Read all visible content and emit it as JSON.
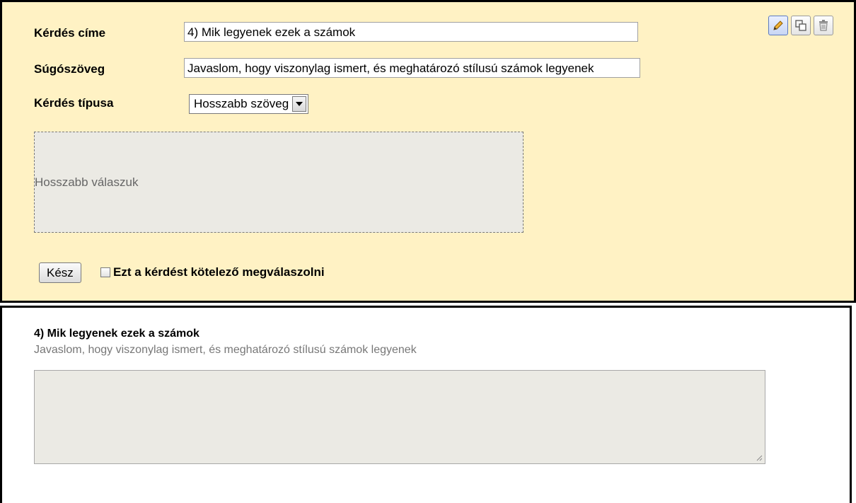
{
  "editor": {
    "title_label": "Kérdés címe",
    "title_value": "4) Mik legyenek ezek a számok",
    "help_label": "Súgószöveg",
    "help_value": "Javaslom, hogy viszonylag ismert, és meghatározó stílusú számok legyenek",
    "type_label": "Kérdés típusa",
    "type_selected": "Hosszabb szöveg",
    "answer_placeholder": "Hosszabb válaszuk",
    "done_button": "Kész",
    "required_label": "Ezt a kérdést kötelező megválaszolni",
    "required_checked": false,
    "toolbar": {
      "edit_icon": "pencil-icon",
      "duplicate_icon": "duplicate-icon",
      "delete_icon": "trash-icon"
    },
    "background_color": "#fff2c4"
  },
  "preview": {
    "question_title": "4) Mik legyenek ezek a számok",
    "help_text": "Javaslom, hogy viszonylag ismert, és meghatározó stílusú számok legyenek"
  }
}
